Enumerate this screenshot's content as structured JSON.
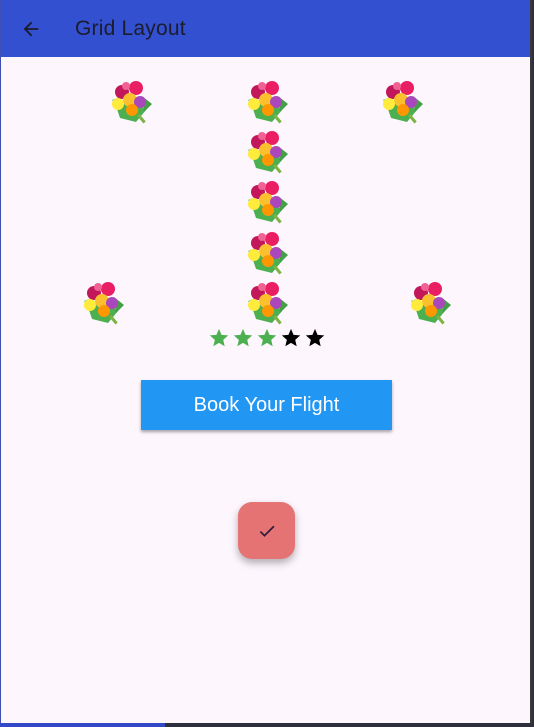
{
  "appbar": {
    "title": "Grid Layout",
    "back_icon": "arrow-left-icon",
    "background": "#3250cf"
  },
  "bouquets": [
    {
      "id": "top-left"
    },
    {
      "id": "top-center"
    },
    {
      "id": "top-right"
    },
    {
      "id": "center-2"
    },
    {
      "id": "center-3"
    },
    {
      "id": "center-4"
    },
    {
      "id": "bottom-left"
    },
    {
      "id": "center-5"
    },
    {
      "id": "bottom-right"
    }
  ],
  "rating": {
    "value": 3,
    "max": 5,
    "filled_color": "#4caf50",
    "empty_color": "#000000"
  },
  "book_button": {
    "label": "Book Your Flight",
    "color": "#2196f3"
  },
  "fab": {
    "icon": "check-icon",
    "color": "#e57373"
  }
}
